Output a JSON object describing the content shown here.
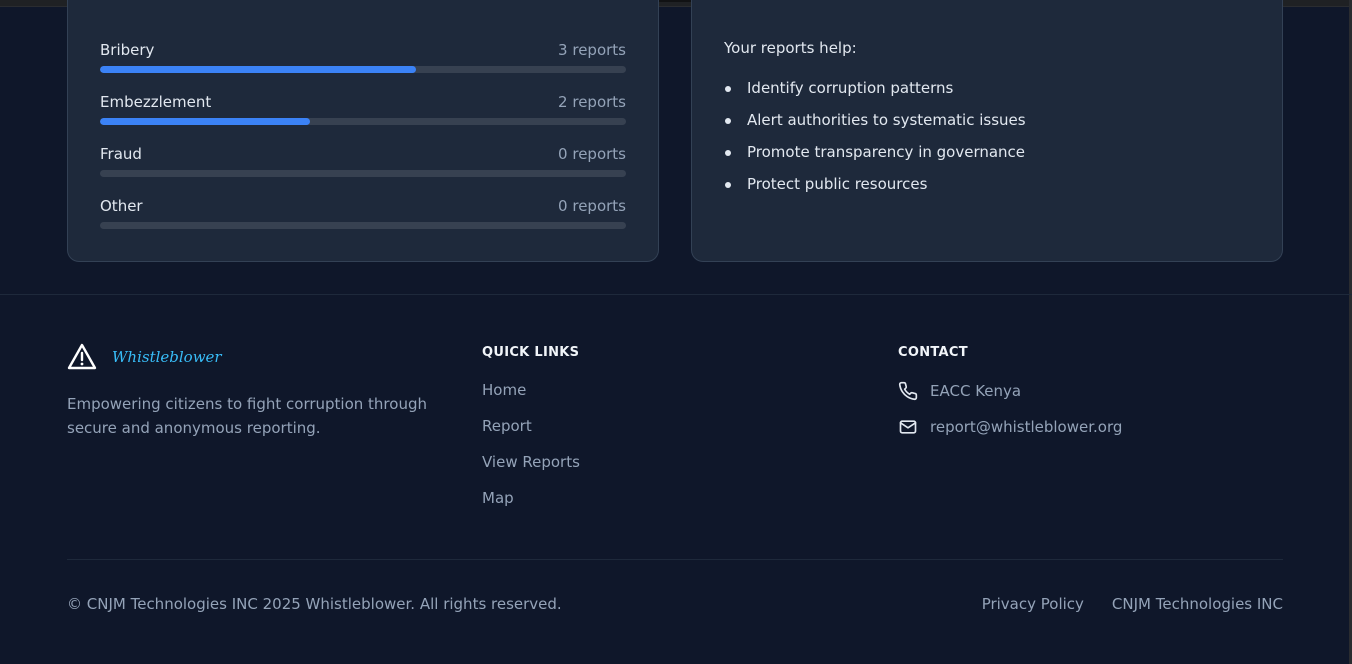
{
  "categories": [
    {
      "name": "Bribery",
      "count": "3 reports",
      "fraction": 0.6
    },
    {
      "name": "Embezzlement",
      "count": "2 reports",
      "fraction": 0.4
    },
    {
      "name": "Fraud",
      "count": "0 reports",
      "fraction": 0
    },
    {
      "name": "Other",
      "count": "0 reports",
      "fraction": 0
    }
  ],
  "help": {
    "title": "Your reports help:",
    "items": [
      "Identify corruption patterns",
      "Alert authorities to systematic issues",
      "Promote transparency in governance",
      "Protect public resources"
    ]
  },
  "footer": {
    "brand_name": "Whistleblower",
    "brand_icon": "warning-triangle-icon",
    "tagline": "Empowering citizens to fight corruption through secure and anonymous reporting.",
    "quick_links_heading": "QUICK LINKS",
    "quick_links": [
      "Home",
      "Report",
      "View Reports",
      "Map"
    ],
    "contact_heading": "CONTACT",
    "contact_phone": "EACC Kenya",
    "contact_email": "report@whistleblower.org",
    "copyright": "© CNJM Technologies INC 2025 Whistleblower. All rights reserved.",
    "legal_links": [
      "Privacy Policy",
      "CNJM Technologies INC"
    ]
  },
  "colors": {
    "accent": "#3b82f6",
    "background": "#0f172a",
    "card": "#1e293b",
    "brand": "#38bdf8"
  }
}
